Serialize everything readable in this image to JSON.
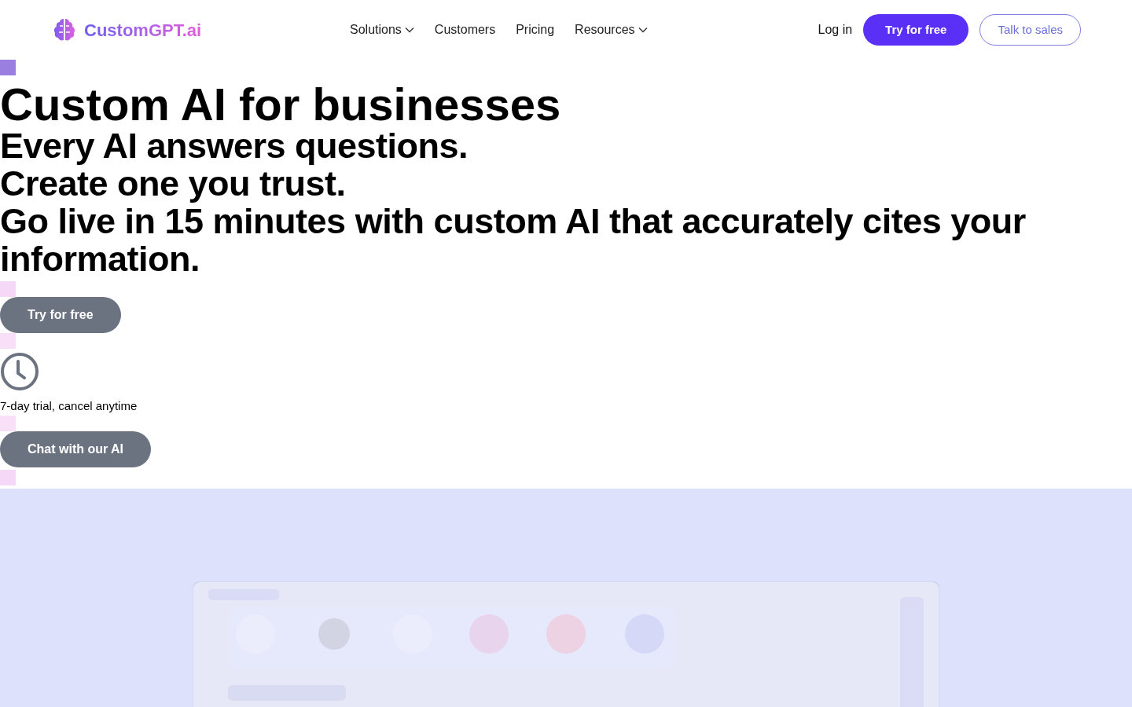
{
  "header": {
    "logo": "CustomGPT.ai",
    "nav": [
      {
        "label": "Solutions",
        "has_menu": true
      },
      {
        "label": "Customers",
        "has_menu": false
      },
      {
        "label": "Pricing",
        "has_menu": false
      },
      {
        "label": "Resources",
        "has_menu": true
      }
    ],
    "login": "Log in",
    "primary_button": "Try for free",
    "secondary_button": "Talk to sales"
  },
  "hero": {
    "title": "Custom AI for businesses",
    "subtitle_lines": [
      "Every AI answers questions.",
      "Create one you trust.",
      "Go live in 15 minutes with custom AI that accurately cites your information."
    ],
    "try_button": "Try for free",
    "trial_note": "7-day trial, cancel anytime",
    "chat_button": "Chat with our AI"
  }
}
